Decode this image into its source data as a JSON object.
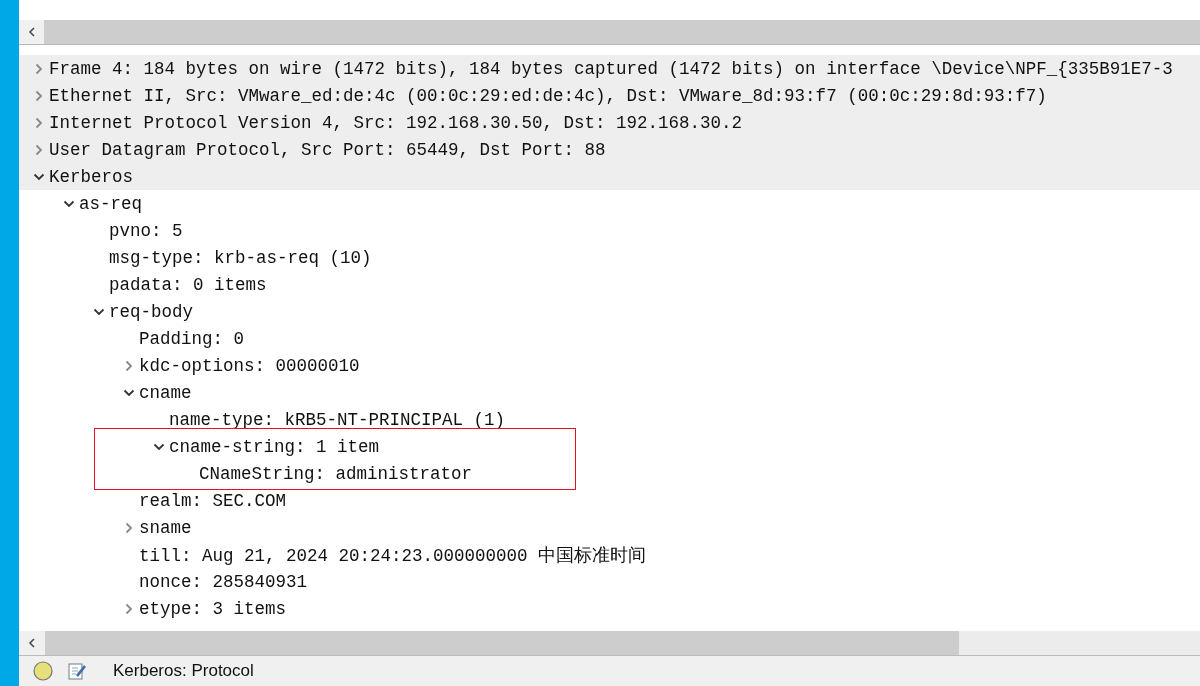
{
  "tree": [
    {
      "label": "Frame 4: 184 bytes on wire (1472 bits), 184 bytes captured (1472 bits) on interface \\Device\\NPF_{335B91E7-3",
      "expanded": false
    },
    {
      "label": "Ethernet II, Src: VMware_ed:de:4c (00:0c:29:ed:de:4c), Dst: VMware_8d:93:f7 (00:0c:29:8d:93:f7)",
      "expanded": false
    },
    {
      "label": "Internet Protocol Version 4, Src: 192.168.30.50, Dst: 192.168.30.2",
      "expanded": false
    },
    {
      "label": "User Datagram Protocol, Src Port: 65449, Dst Port: 88",
      "expanded": false
    },
    {
      "label": "Kerberos",
      "expanded": true,
      "children": [
        {
          "label": "as-req",
          "expanded": true,
          "children": [
            {
              "label": "pvno: 5"
            },
            {
              "label": "msg-type: krb-as-req (10)"
            },
            {
              "label": "padata: 0 items"
            },
            {
              "label": "req-body",
              "expanded": true,
              "children": [
                {
                  "label": "Padding: 0"
                },
                {
                  "label": "kdc-options: 00000010",
                  "expanded": false
                },
                {
                  "label": "cname",
                  "expanded": true,
                  "children": [
                    {
                      "label": "name-type: kRB5-NT-PRINCIPAL (1)"
                    },
                    {
                      "label": "cname-string: 1 item",
                      "expanded": true,
                      "highlighted": true,
                      "children": [
                        {
                          "label": "CNameString: administrator"
                        }
                      ]
                    }
                  ]
                },
                {
                  "label": "realm: SEC.COM"
                },
                {
                  "label": "sname",
                  "expanded": false
                },
                {
                  "label": "till: Aug 21, 2024 20:24:23.000000000 中国标准时间"
                },
                {
                  "label": "nonce: 285840931"
                },
                {
                  "label": "etype: 3 items",
                  "expanded": false
                }
              ]
            }
          ]
        }
      ]
    }
  ],
  "status_bar": {
    "text": "Kerberos: Protocol"
  }
}
